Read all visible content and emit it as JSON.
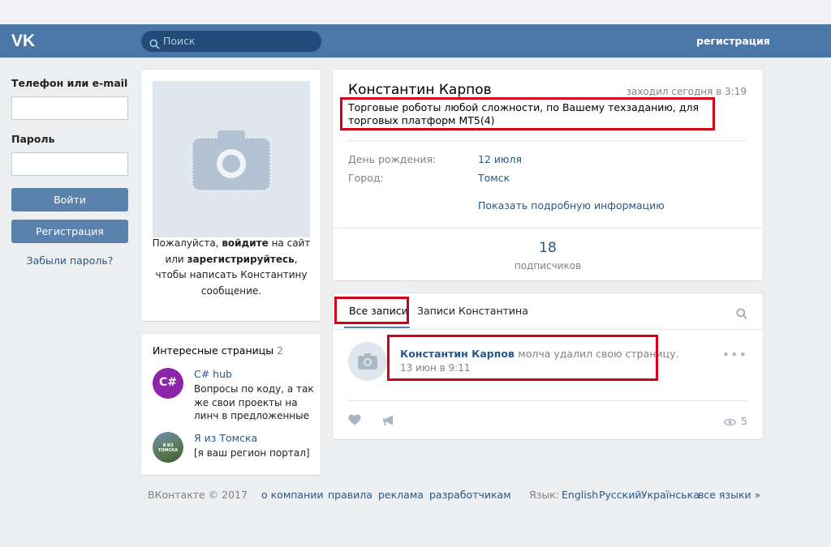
{
  "header": {
    "search_placeholder": "Поиск",
    "register_link": "регистрация"
  },
  "login": {
    "phone_label": "Телефон или e-mail",
    "password_label": "Пароль",
    "login_button": "Войти",
    "register_button": "Регистрация",
    "forgot_link": "Забыли пароль?"
  },
  "photo_card": {
    "text_1": "Пожалуйста, ",
    "link_login": "войдите",
    "text_2": " на сайт или ",
    "link_register": "зарегистрируйтесь",
    "text_3": ", чтобы написать Константину сообщение."
  },
  "interesting_pages": {
    "title": "Интересные страницы",
    "count": "2",
    "items": [
      {
        "name": "C# hub",
        "description": "Вопросы по коду, а так же свои проекты на линч в предложенные",
        "avatar_text": "C#"
      },
      {
        "name": "Я из Томска",
        "description": "[я ваш регион портал]",
        "avatar_text": "Я ИЗ ТОМСКА"
      }
    ]
  },
  "profile": {
    "name": "Константин Карпов",
    "online": "заходил сегодня в 3:19",
    "status": "Торговые роботы любой сложности, по Вашему техзаданию, для торговых платформ МТ5(4)",
    "birthday_label": "День рождения:",
    "birthday_value": "12 июля",
    "city_label": "Город:",
    "city_value": "Томск",
    "show_more": "Показать подробную информацию",
    "subscribers_count": "18",
    "subscribers_label": "подписчиков"
  },
  "wall": {
    "tab_all": "Все записи",
    "tab_own": "Записи Константина",
    "post": {
      "author": "Константин Карпов",
      "action": "молча удалил свою страницу.",
      "time": "13 июн в 9:11",
      "views": "5"
    }
  },
  "footer": {
    "copyright": "ВКонтакте © 2017",
    "links": [
      "о компании",
      "правила",
      "реклама",
      "разработчикам"
    ],
    "language_label": "Язык:",
    "languages": [
      "English",
      "Русский",
      "Українська",
      "все языки »"
    ]
  },
  "colors": {
    "header_bg": "#4a76a8",
    "link": "#2a5885",
    "highlight": "#d4001a",
    "button": "#5b82ac"
  }
}
